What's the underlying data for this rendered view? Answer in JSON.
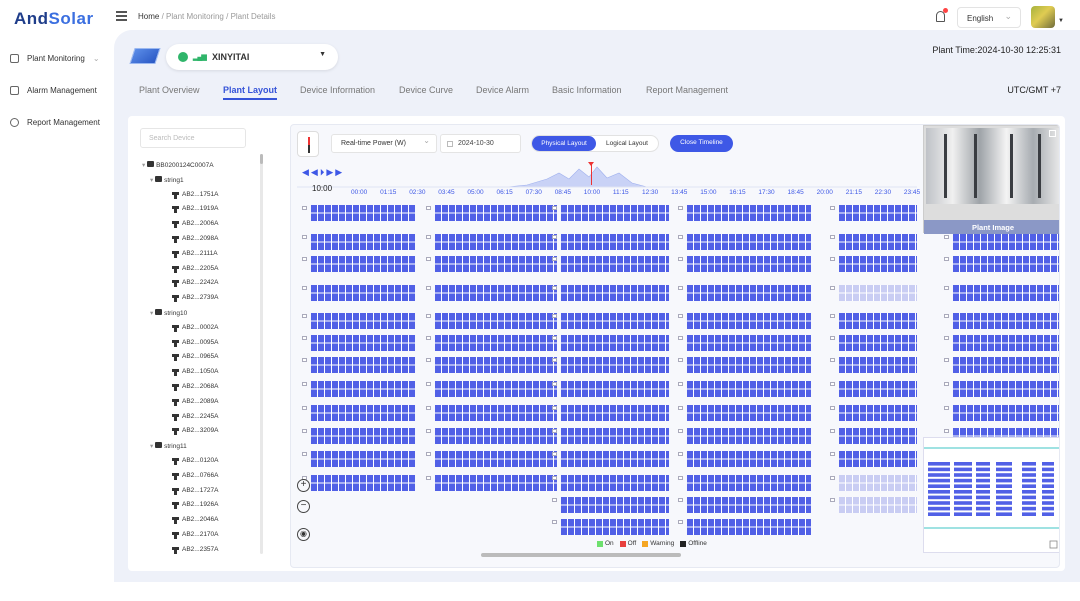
{
  "app": {
    "logo_a": "And",
    "logo_b": "Solar"
  },
  "breadcrumb": {
    "home": "Home",
    "sep1": "/",
    "level1": "Plant Monitoring",
    "sep2": "/",
    "level2": "Plant Details"
  },
  "header": {
    "language": "English"
  },
  "sidebar": {
    "items": [
      {
        "label": "Plant Monitoring",
        "icon": "monitor-icon"
      },
      {
        "label": "Alarm Management",
        "icon": "alarm-icon"
      },
      {
        "label": "Report Management",
        "icon": "report-icon"
      }
    ]
  },
  "plant": {
    "name": "XINYITAI",
    "time_label": "Plant Time:2024-10-30 12:25:31",
    "timezone": "UTC/GMT +7"
  },
  "tabs": [
    {
      "label": "Plant Overview"
    },
    {
      "label": "Plant Layout",
      "active": true
    },
    {
      "label": "Device Information"
    },
    {
      "label": "Device Curve"
    },
    {
      "label": "Device Alarm"
    },
    {
      "label": "Basic Information"
    },
    {
      "label": "Report Management"
    }
  ],
  "tree": {
    "search_placeholder": "Search Device",
    "root": "BB0200124C0007A",
    "strings": [
      {
        "name": "string1",
        "devices": [
          "AB2...1751A",
          "AB2...1919A",
          "AB2...2006A",
          "AB2...2098A",
          "AB2...2111A",
          "AB2...2205A",
          "AB2...2242A",
          "AB2...2739A"
        ]
      },
      {
        "name": "string10",
        "devices": [
          "AB2...0002A",
          "AB2...0095A",
          "AB2...0965A",
          "AB2...1050A",
          "AB2...2068A",
          "AB2...2089A",
          "AB2...2245A",
          "AB2...3209A"
        ]
      },
      {
        "name": "string11",
        "devices": [
          "AB2...0120A",
          "AB2...0766A",
          "AB2...1727A",
          "AB2...1926A",
          "AB2...2046A",
          "AB2...2170A",
          "AB2...2357A"
        ]
      }
    ]
  },
  "layout_toolbar": {
    "metric": "Real-time Power (W)",
    "date": "2024-10-30",
    "physical": "Physical Layout",
    "logical": "Logical Layout",
    "close_timeline": "Close Timeline"
  },
  "timeline": {
    "current": "10:00",
    "ticks": [
      "00:00",
      "01:15",
      "02:30",
      "03:45",
      "05:00",
      "06:15",
      "07:30",
      "08:45",
      "10:00",
      "11:15",
      "12:30",
      "13:45",
      "15:00",
      "16:15",
      "17:30",
      "18:45",
      "20:00",
      "21:15",
      "22:30",
      "23:45"
    ]
  },
  "photo": {
    "caption": "Plant Image"
  },
  "legend": [
    {
      "label": "On",
      "color": "#6ee06e"
    },
    {
      "label": "Off",
      "color": "#e8403d"
    },
    {
      "label": "Warning",
      "color": "#f5a623"
    },
    {
      "label": "Offline",
      "color": "#222222"
    }
  ],
  "colors": {
    "accent": "#3e58e6",
    "panel": "#5160e6",
    "panel_light": "#c9cdf3"
  }
}
